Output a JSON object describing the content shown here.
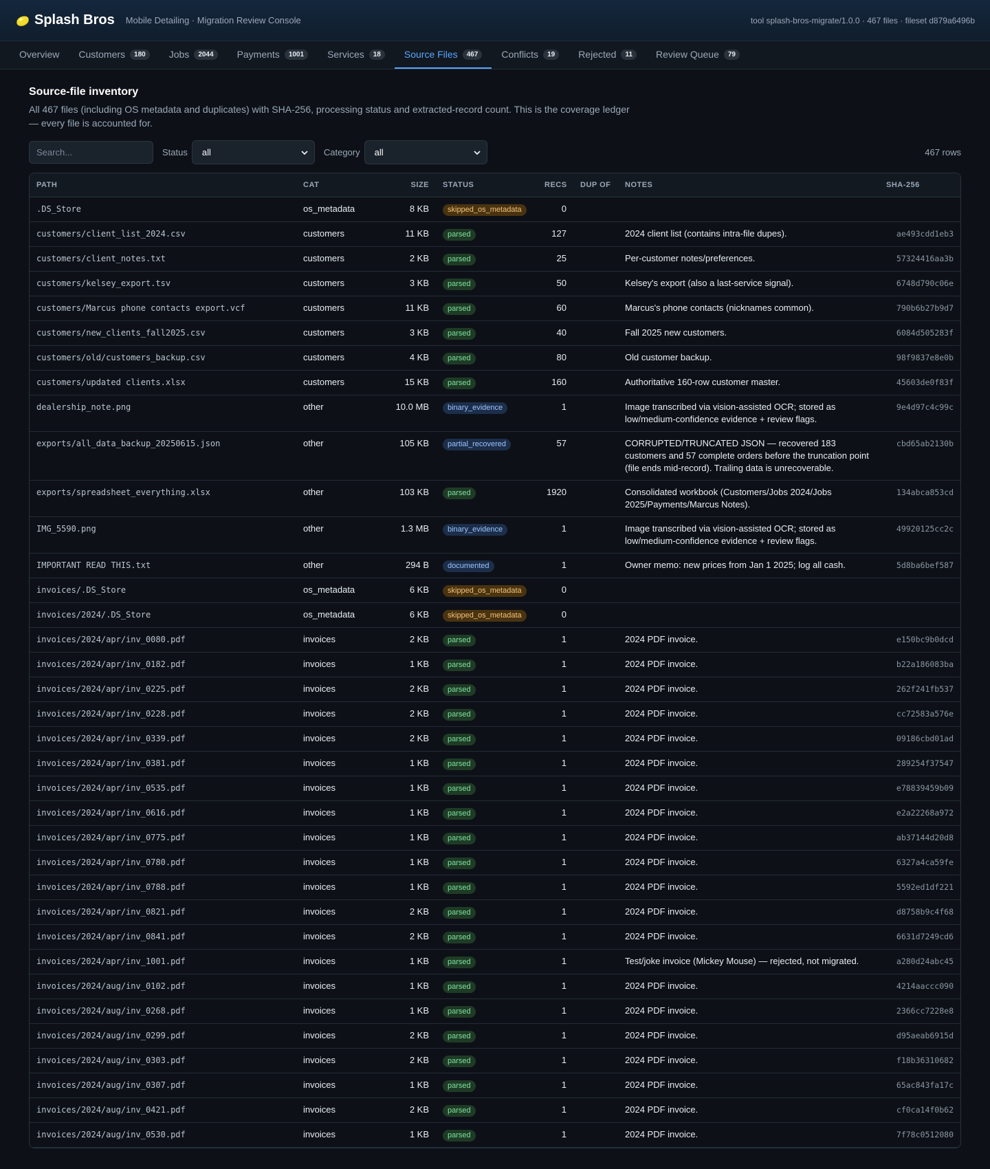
{
  "header": {
    "brand": "Splash Bros",
    "subtitle": "Mobile Detailing · Migration Review Console",
    "meta": "tool splash-bros-migrate/1.0.0 · 467 files · fileset d879a6496b",
    "logo_icon": "soap-bar-icon"
  },
  "tabs": [
    {
      "label": "Overview",
      "count": "",
      "active": false
    },
    {
      "label": "Customers",
      "count": "180",
      "active": false
    },
    {
      "label": "Jobs",
      "count": "2044",
      "active": false
    },
    {
      "label": "Payments",
      "count": "1001",
      "active": false
    },
    {
      "label": "Services",
      "count": "18",
      "active": false
    },
    {
      "label": "Source Files",
      "count": "467",
      "active": true
    },
    {
      "label": "Conflicts",
      "count": "19",
      "active": false
    },
    {
      "label": "Rejected",
      "count": "11",
      "active": false
    },
    {
      "label": "Review Queue",
      "count": "79",
      "active": false
    }
  ],
  "page": {
    "title": "Source-file inventory",
    "description": "All 467 files (including OS metadata and duplicates) with SHA-256, processing status and extracted-record count. This is the coverage ledger — every file is accounted for."
  },
  "controls": {
    "search_placeholder": "Search...",
    "status_label": "Status",
    "status_value": "all",
    "category_label": "Category",
    "category_value": "all",
    "row_count": "467 rows"
  },
  "table": {
    "columns": [
      "PATH",
      "CAT",
      "SIZE",
      "STATUS",
      "RECS",
      "DUP OF",
      "NOTES",
      "SHA-256"
    ],
    "rows": [
      {
        "path": ".DS_Store",
        "cat": "os_metadata",
        "size": "8 KB",
        "status": "skipped_os_metadata",
        "recs": "0",
        "dup": "",
        "notes": "",
        "sha": ""
      },
      {
        "path": "customers/client_list_2024.csv",
        "cat": "customers",
        "size": "11 KB",
        "status": "parsed",
        "recs": "127",
        "dup": "",
        "notes": "2024 client list (contains intra-file dupes).",
        "sha": "ae493cdd1eb3"
      },
      {
        "path": "customers/client_notes.txt",
        "cat": "customers",
        "size": "2 KB",
        "status": "parsed",
        "recs": "25",
        "dup": "",
        "notes": "Per-customer notes/preferences.",
        "sha": "57324416aa3b"
      },
      {
        "path": "customers/kelsey_export.tsv",
        "cat": "customers",
        "size": "3 KB",
        "status": "parsed",
        "recs": "50",
        "dup": "",
        "notes": "Kelsey's export (also a last-service signal).",
        "sha": "6748d790c06e"
      },
      {
        "path": "customers/Marcus phone contacts export.vcf",
        "cat": "customers",
        "size": "11 KB",
        "status": "parsed",
        "recs": "60",
        "dup": "",
        "notes": "Marcus's phone contacts (nicknames common).",
        "sha": "790b6b27b9d7"
      },
      {
        "path": "customers/new_clients_fall2025.csv",
        "cat": "customers",
        "size": "3 KB",
        "status": "parsed",
        "recs": "40",
        "dup": "",
        "notes": "Fall 2025 new customers.",
        "sha": "6084d505283f"
      },
      {
        "path": "customers/old/customers_backup.csv",
        "cat": "customers",
        "size": "4 KB",
        "status": "parsed",
        "recs": "80",
        "dup": "",
        "notes": "Old customer backup.",
        "sha": "98f9837e8e0b"
      },
      {
        "path": "customers/updated clients.xlsx",
        "cat": "customers",
        "size": "15 KB",
        "status": "parsed",
        "recs": "160",
        "dup": "",
        "notes": "Authoritative 160-row customer master.",
        "sha": "45603de0f83f"
      },
      {
        "path": "dealership_note.png",
        "cat": "other",
        "size": "10.0 MB",
        "status": "binary_evidence",
        "recs": "1",
        "dup": "",
        "notes": "Image transcribed via vision-assisted OCR; stored as low/medium-confidence evidence + review flags.",
        "sha": "9e4d97c4c99c"
      },
      {
        "path": "exports/all_data_backup_20250615.json",
        "cat": "other",
        "size": "105 KB",
        "status": "partial_recovered",
        "recs": "57",
        "dup": "",
        "notes": "CORRUPTED/TRUNCATED JSON — recovered 183 customers and 57 complete orders before the truncation point (file ends mid-record). Trailing data is unrecoverable.",
        "sha": "cbd65ab2130b"
      },
      {
        "path": "exports/spreadsheet_everything.xlsx",
        "cat": "other",
        "size": "103 KB",
        "status": "parsed",
        "recs": "1920",
        "dup": "",
        "notes": "Consolidated workbook (Customers/Jobs 2024/Jobs 2025/Payments/Marcus Notes).",
        "sha": "134abca853cd"
      },
      {
        "path": "IMG_5590.png",
        "cat": "other",
        "size": "1.3 MB",
        "status": "binary_evidence",
        "recs": "1",
        "dup": "",
        "notes": "Image transcribed via vision-assisted OCR; stored as low/medium-confidence evidence + review flags.",
        "sha": "49920125cc2c"
      },
      {
        "path": "IMPORTANT READ THIS.txt",
        "cat": "other",
        "size": "294 B",
        "status": "documented",
        "recs": "1",
        "dup": "",
        "notes": "Owner memo: new prices from Jan 1 2025; log all cash.",
        "sha": "5d8ba6bef587"
      },
      {
        "path": "invoices/.DS_Store",
        "cat": "os_metadata",
        "size": "6 KB",
        "status": "skipped_os_metadata",
        "recs": "0",
        "dup": "",
        "notes": "",
        "sha": ""
      },
      {
        "path": "invoices/2024/.DS_Store",
        "cat": "os_metadata",
        "size": "6 KB",
        "status": "skipped_os_metadata",
        "recs": "0",
        "dup": "",
        "notes": "",
        "sha": ""
      },
      {
        "path": "invoices/2024/apr/inv_0080.pdf",
        "cat": "invoices",
        "size": "2 KB",
        "status": "parsed",
        "recs": "1",
        "dup": "",
        "notes": "2024 PDF invoice.",
        "sha": "e150bc9b0dcd"
      },
      {
        "path": "invoices/2024/apr/inv_0182.pdf",
        "cat": "invoices",
        "size": "1 KB",
        "status": "parsed",
        "recs": "1",
        "dup": "",
        "notes": "2024 PDF invoice.",
        "sha": "b22a186083ba"
      },
      {
        "path": "invoices/2024/apr/inv_0225.pdf",
        "cat": "invoices",
        "size": "2 KB",
        "status": "parsed",
        "recs": "1",
        "dup": "",
        "notes": "2024 PDF invoice.",
        "sha": "262f241fb537"
      },
      {
        "path": "invoices/2024/apr/inv_0228.pdf",
        "cat": "invoices",
        "size": "2 KB",
        "status": "parsed",
        "recs": "1",
        "dup": "",
        "notes": "2024 PDF invoice.",
        "sha": "cc72583a576e"
      },
      {
        "path": "invoices/2024/apr/inv_0339.pdf",
        "cat": "invoices",
        "size": "2 KB",
        "status": "parsed",
        "recs": "1",
        "dup": "",
        "notes": "2024 PDF invoice.",
        "sha": "09186cbd01ad"
      },
      {
        "path": "invoices/2024/apr/inv_0381.pdf",
        "cat": "invoices",
        "size": "1 KB",
        "status": "parsed",
        "recs": "1",
        "dup": "",
        "notes": "2024 PDF invoice.",
        "sha": "289254f37547"
      },
      {
        "path": "invoices/2024/apr/inv_0535.pdf",
        "cat": "invoices",
        "size": "1 KB",
        "status": "parsed",
        "recs": "1",
        "dup": "",
        "notes": "2024 PDF invoice.",
        "sha": "e78839459b09"
      },
      {
        "path": "invoices/2024/apr/inv_0616.pdf",
        "cat": "invoices",
        "size": "1 KB",
        "status": "parsed",
        "recs": "1",
        "dup": "",
        "notes": "2024 PDF invoice.",
        "sha": "e2a22268a972"
      },
      {
        "path": "invoices/2024/apr/inv_0775.pdf",
        "cat": "invoices",
        "size": "1 KB",
        "status": "parsed",
        "recs": "1",
        "dup": "",
        "notes": "2024 PDF invoice.",
        "sha": "ab37144d20d8"
      },
      {
        "path": "invoices/2024/apr/inv_0780.pdf",
        "cat": "invoices",
        "size": "1 KB",
        "status": "parsed",
        "recs": "1",
        "dup": "",
        "notes": "2024 PDF invoice.",
        "sha": "6327a4ca59fe"
      },
      {
        "path": "invoices/2024/apr/inv_0788.pdf",
        "cat": "invoices",
        "size": "1 KB",
        "status": "parsed",
        "recs": "1",
        "dup": "",
        "notes": "2024 PDF invoice.",
        "sha": "5592ed1df221"
      },
      {
        "path": "invoices/2024/apr/inv_0821.pdf",
        "cat": "invoices",
        "size": "2 KB",
        "status": "parsed",
        "recs": "1",
        "dup": "",
        "notes": "2024 PDF invoice.",
        "sha": "d8758b9c4f68"
      },
      {
        "path": "invoices/2024/apr/inv_0841.pdf",
        "cat": "invoices",
        "size": "2 KB",
        "status": "parsed",
        "recs": "1",
        "dup": "",
        "notes": "2024 PDF invoice.",
        "sha": "6631d7249cd6"
      },
      {
        "path": "invoices/2024/apr/inv_1001.pdf",
        "cat": "invoices",
        "size": "1 KB",
        "status": "parsed",
        "recs": "1",
        "dup": "",
        "notes": "Test/joke invoice (Mickey Mouse) — rejected, not migrated.",
        "sha": "a280d24abc45"
      },
      {
        "path": "invoices/2024/aug/inv_0102.pdf",
        "cat": "invoices",
        "size": "1 KB",
        "status": "parsed",
        "recs": "1",
        "dup": "",
        "notes": "2024 PDF invoice.",
        "sha": "4214aaccc090"
      },
      {
        "path": "invoices/2024/aug/inv_0268.pdf",
        "cat": "invoices",
        "size": "1 KB",
        "status": "parsed",
        "recs": "1",
        "dup": "",
        "notes": "2024 PDF invoice.",
        "sha": "2366cc7228e8"
      },
      {
        "path": "invoices/2024/aug/inv_0299.pdf",
        "cat": "invoices",
        "size": "2 KB",
        "status": "parsed",
        "recs": "1",
        "dup": "",
        "notes": "2024 PDF invoice.",
        "sha": "d95aeab6915d"
      },
      {
        "path": "invoices/2024/aug/inv_0303.pdf",
        "cat": "invoices",
        "size": "2 KB",
        "status": "parsed",
        "recs": "1",
        "dup": "",
        "notes": "2024 PDF invoice.",
        "sha": "f18b36310682"
      },
      {
        "path": "invoices/2024/aug/inv_0307.pdf",
        "cat": "invoices",
        "size": "1 KB",
        "status": "parsed",
        "recs": "1",
        "dup": "",
        "notes": "2024 PDF invoice.",
        "sha": "65ac843fa17c"
      },
      {
        "path": "invoices/2024/aug/inv_0421.pdf",
        "cat": "invoices",
        "size": "2 KB",
        "status": "parsed",
        "recs": "1",
        "dup": "",
        "notes": "2024 PDF invoice.",
        "sha": "cf0ca14f0b62"
      },
      {
        "path": "invoices/2024/aug/inv_0530.pdf",
        "cat": "invoices",
        "size": "1 KB",
        "status": "parsed",
        "recs": "1",
        "dup": "",
        "notes": "2024 PDF invoice.",
        "sha": "7f78c0512080"
      }
    ]
  },
  "colors": {
    "background": "#0d1117",
    "accent": "#58a6ff",
    "parsed": "#7ee2a0",
    "skipped": "#f3c377",
    "evidence": "#9cc3ff"
  }
}
